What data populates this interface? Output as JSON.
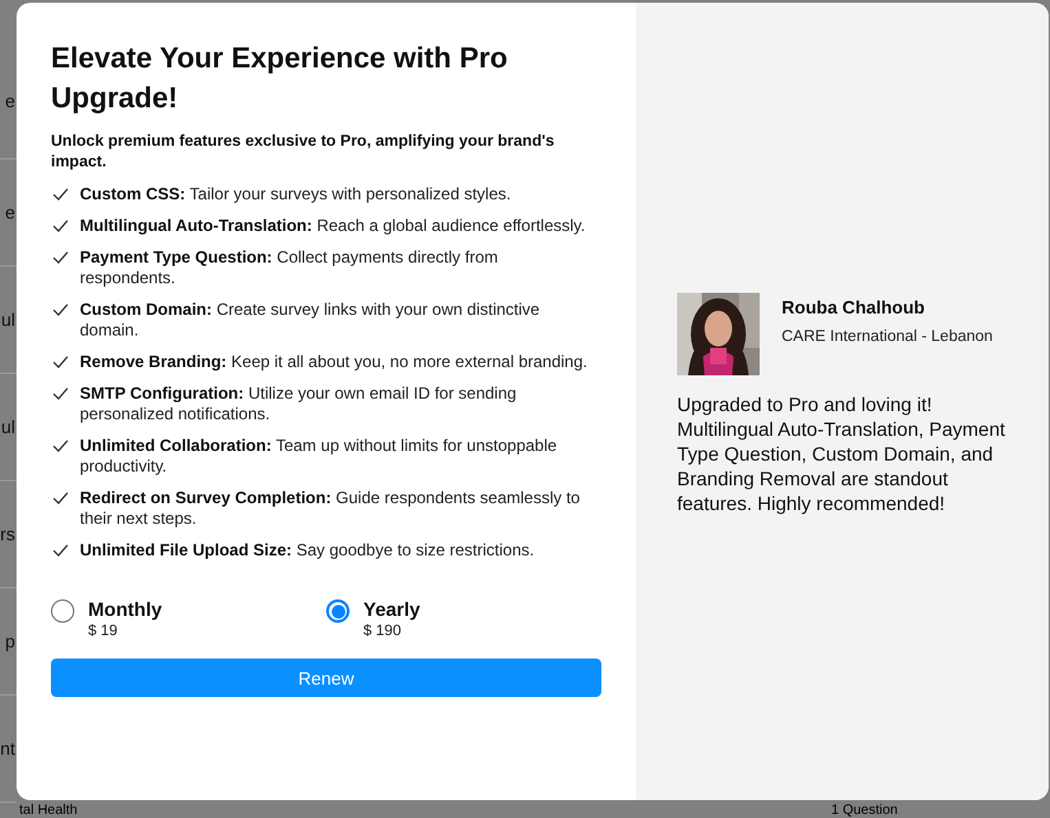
{
  "background_rows": [
    "e",
    "e",
    "ul",
    "ul",
    "rs",
    "p",
    "nt"
  ],
  "background_footer": [
    "tal Health",
    "1 Question"
  ],
  "modal": {
    "title": "Elevate Your Experience with Pro Upgrade!",
    "subtitle": "Unlock premium features exclusive to Pro, amplifying your brand's impact.",
    "features": [
      {
        "name": "Custom CSS:",
        "text": "Tailor your surveys with personalized styles."
      },
      {
        "name": "Multilingual Auto-Translation:",
        "text": "Reach a global audience effortlessly."
      },
      {
        "name": "Payment Type Question:",
        "text": "Collect payments directly from respondents."
      },
      {
        "name": "Custom Domain:",
        "text": "Create survey links with your own distinctive domain."
      },
      {
        "name": "Remove Branding:",
        "text": "Keep it all about you, no more external branding."
      },
      {
        "name": "SMTP Configuration:",
        "text": "Utilize your own email ID for sending personalized notifications."
      },
      {
        "name": "Unlimited Collaboration:",
        "text": "Team up without limits for unstoppable productivity."
      },
      {
        "name": "Redirect on Survey Completion:",
        "text": "Guide respondents seamlessly to their next steps."
      },
      {
        "name": "Unlimited File Upload Size:",
        "text": "Say goodbye to size restrictions."
      }
    ],
    "plans": [
      {
        "label": "Monthly",
        "price": "$ 19",
        "selected": false
      },
      {
        "label": "Yearly",
        "price": "$ 190",
        "selected": true
      }
    ],
    "button": "Renew",
    "testimonial": {
      "name": "Rouba Chalhoub",
      "organization": "CARE International - Lebanon",
      "quote": "Upgraded to Pro and loving it! Multilingual Auto-Translation, Payment Type Question, Custom Domain, and Branding Removal are standout features. Highly recommended!"
    }
  }
}
